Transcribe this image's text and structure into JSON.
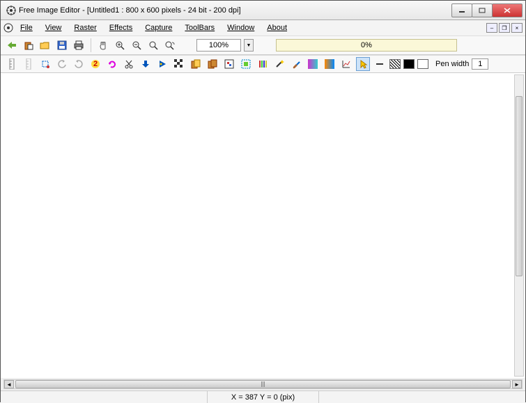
{
  "title": "Free Image Editor - [Untitled1 : 800 x 600 pixels - 24 bit - 200 dpi]",
  "menu": {
    "file": "File",
    "view": "View",
    "raster": "Raster",
    "effects": "Effects",
    "capture": "Capture",
    "toolbars": "ToolBars",
    "window": "Window",
    "about": "About"
  },
  "toolbar1": {
    "zoom": "100%",
    "progress": "0%"
  },
  "toolbar2": {
    "pen_width_label": "Pen width",
    "pen_width_value": "1"
  },
  "status": {
    "coords": "X = 387   Y = 0 (pix)"
  },
  "swatches": {
    "hatch": "diagonal",
    "fg": "#000000",
    "bg": "#ffffff"
  }
}
